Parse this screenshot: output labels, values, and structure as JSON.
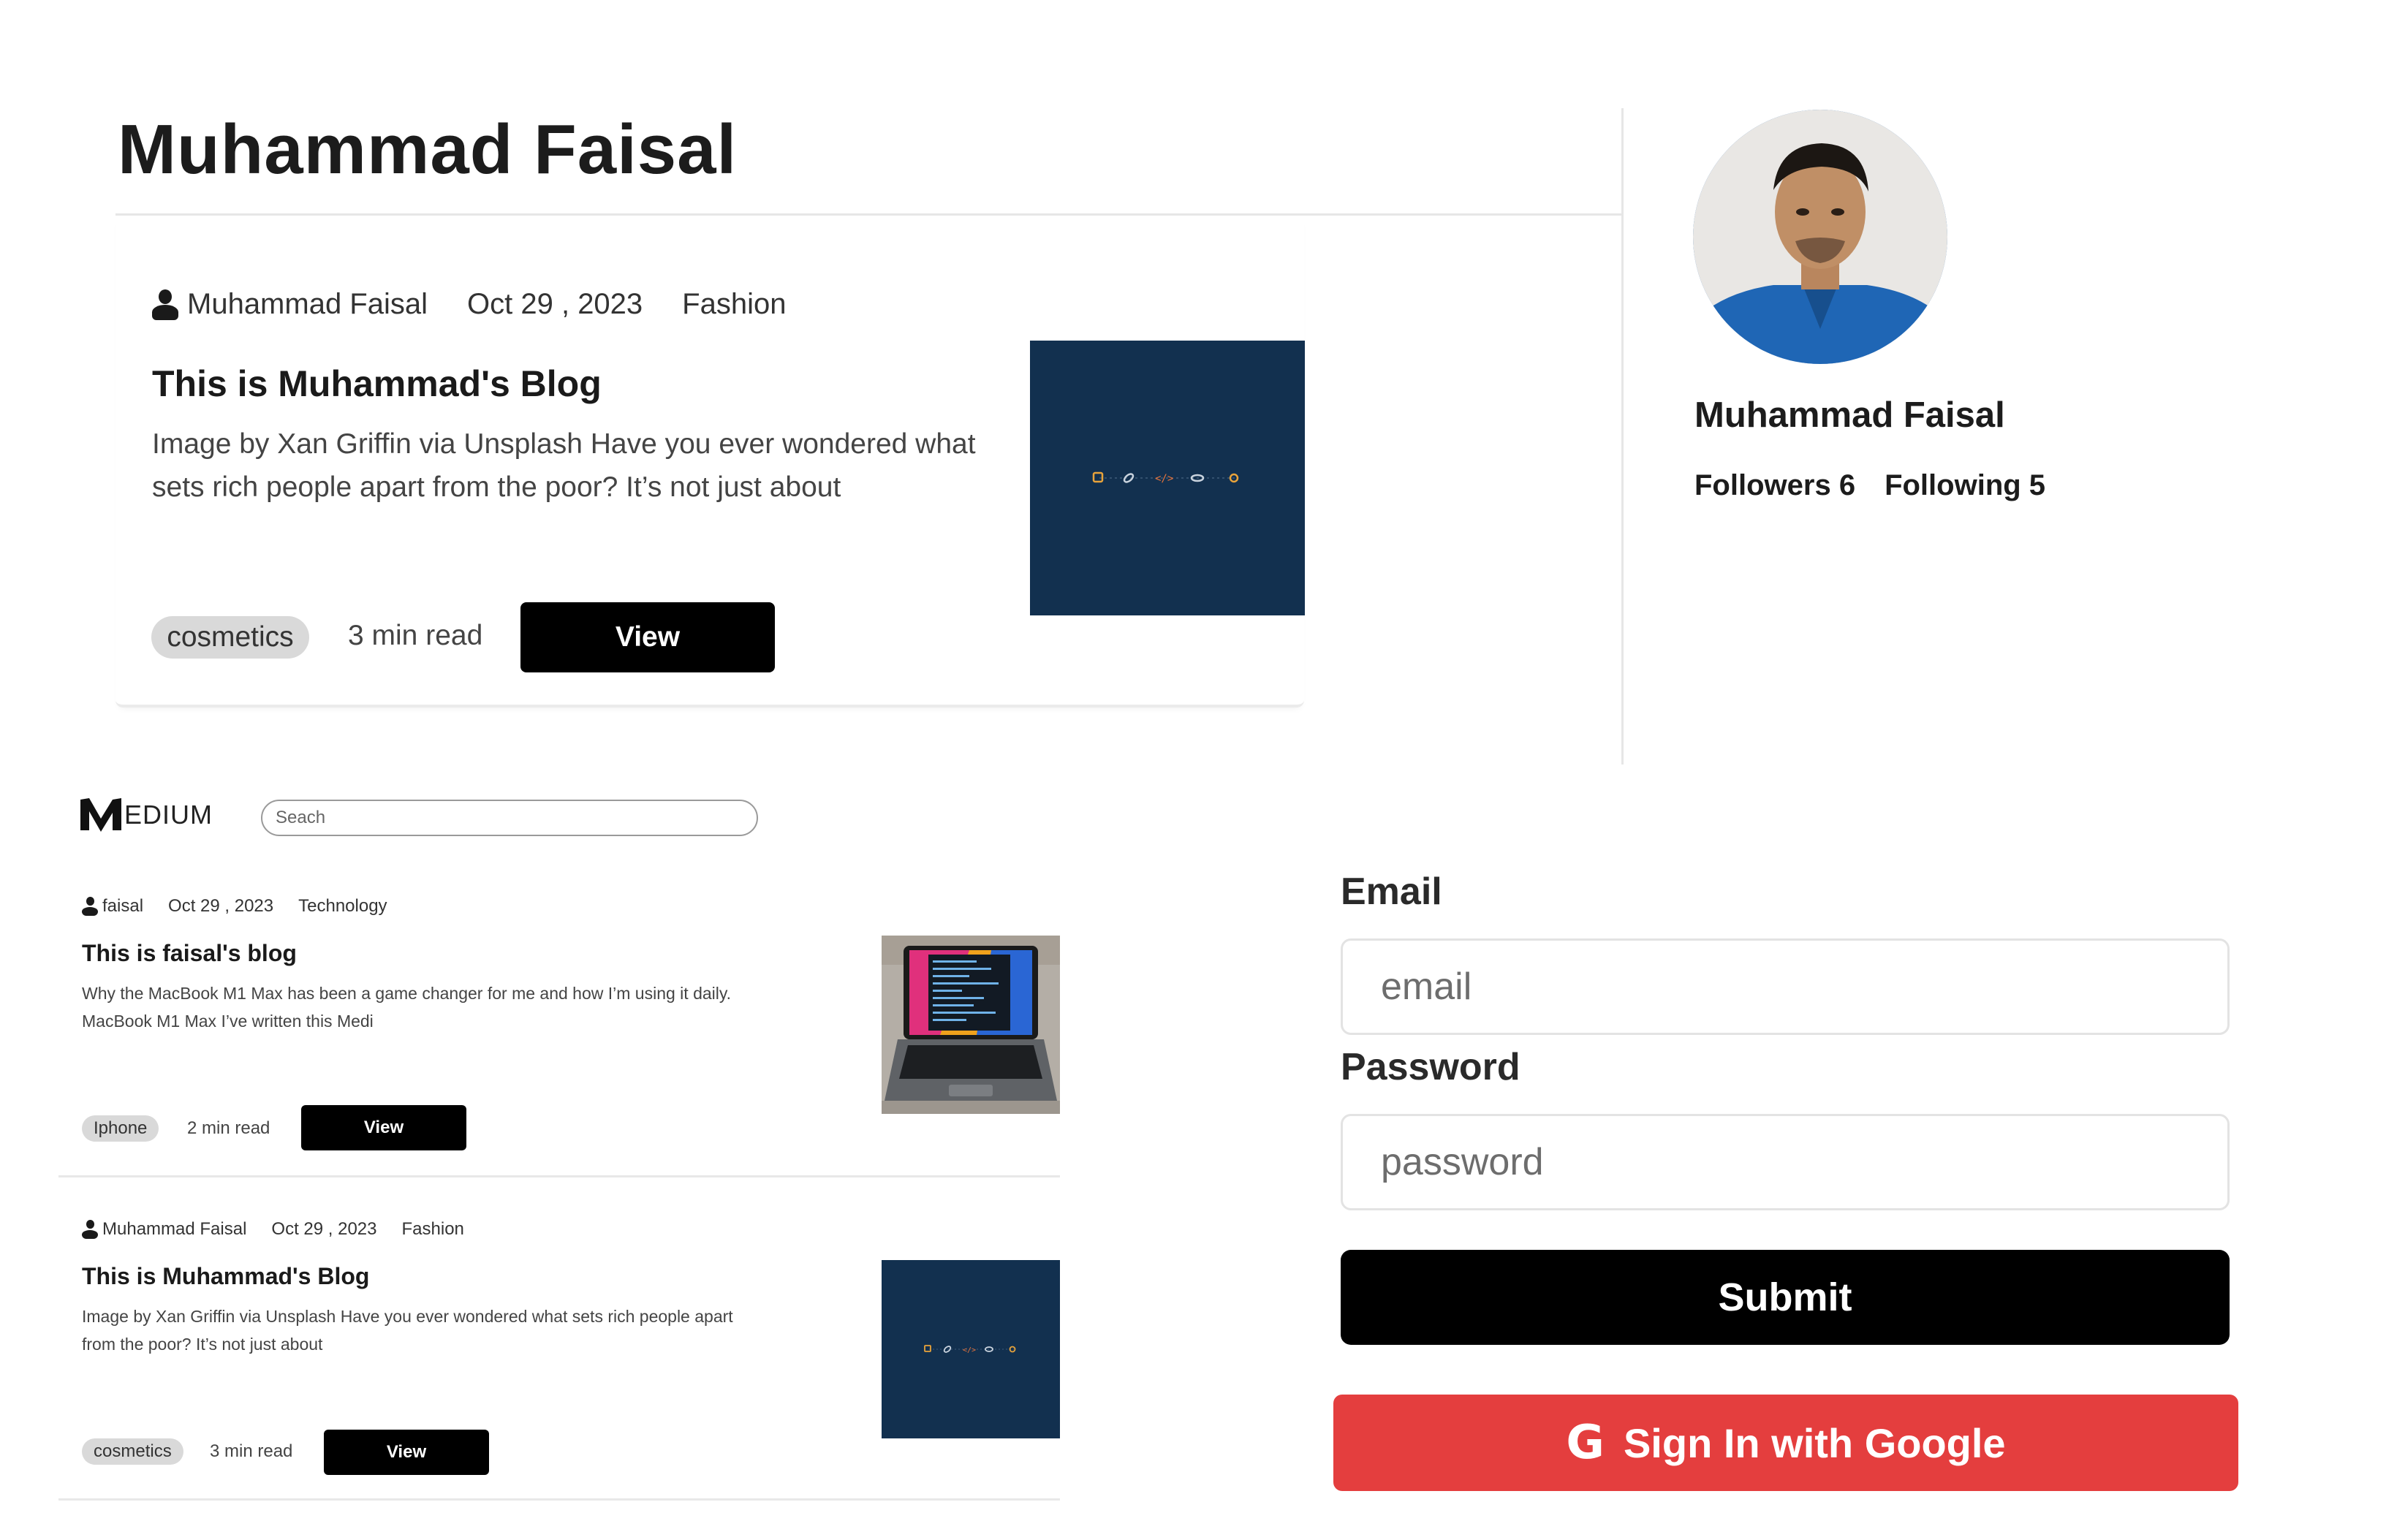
{
  "profile": {
    "title": "Muhammad Faisal",
    "post": {
      "author": "Muhammad Faisal",
      "date": "Oct 29 , 2023",
      "category": "Fashion",
      "title": "This is Muhammad's Blog",
      "excerpt": "Image by Xan Griffin via Unsplash Have you ever wondered what sets rich people apart from the poor? It’s not just about",
      "tag": "cosmetics",
      "read_time": "3 min read",
      "view_label": "View"
    },
    "sidebar": {
      "name": "Muhammad Faisal",
      "followers": "Followers 6",
      "following": "Following 5"
    }
  },
  "feed": {
    "logo_text": "EDIUM",
    "search_placeholder": "Seach",
    "posts": [
      {
        "author": "faisal",
        "date": "Oct 29 , 2023",
        "category": "Technology",
        "title": "This is faisal's blog",
        "excerpt": "Why the MacBook M1 Max has been a game changer for me and how I’m using it daily. MacBook M1 Max I’ve written this Medi",
        "tag": "Iphone",
        "read_time": "2 min read",
        "view_label": "View"
      },
      {
        "author": "Muhammad Faisal",
        "date": "Oct 29 , 2023",
        "category": "Fashion",
        "title": "This is Muhammad's Blog",
        "excerpt": "Image by Xan Griffin via Unsplash Have you ever wondered what sets rich people apart from the poor? It’s not just about",
        "tag": "cosmetics",
        "read_time": "3 min read",
        "view_label": "View"
      }
    ]
  },
  "login": {
    "email_label": "Email",
    "email_placeholder": "email",
    "password_label": "Password",
    "password_placeholder": "password",
    "submit_label": "Submit",
    "google_label": "Sign In with Google",
    "google_color": "#e43e3e"
  },
  "icons": [
    "person-icon",
    "medium-logo-icon",
    "google-icon"
  ]
}
